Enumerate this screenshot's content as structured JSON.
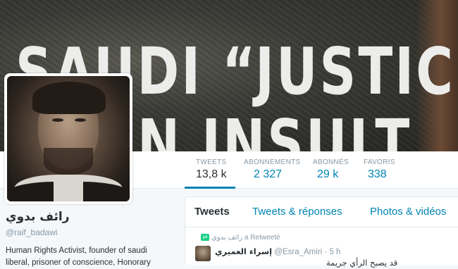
{
  "banner": {
    "line1": "SAUDI “JUSTICE”",
    "line2": "N INSULT"
  },
  "stats": [
    {
      "label": "TWEETS",
      "value": "13,8 k"
    },
    {
      "label": "ABONNEMENTS",
      "value": "2 327"
    },
    {
      "label": "ABONNÉS",
      "value": "29 k"
    },
    {
      "label": "FAVORIS",
      "value": "338"
    }
  ],
  "profile": {
    "name": "رائف بدوي",
    "handle": "@raif_badawi",
    "bio_line1": "Human Rights Activist, founder of saudi",
    "bio_line2": "liberal, prisoner of conscience, Honorary"
  },
  "timeline": {
    "tabs": [
      "Tweets",
      "Tweets & réponses",
      "Photos & vidéos"
    ],
    "retweet_note": "رائف بدوي a Retweeté",
    "tweet": {
      "author": "إسراء العميري",
      "handle": "@Esra_Amiri",
      "time": "5 h",
      "text": "قد يصبح الرأي جريمة"
    }
  },
  "colors": {
    "link": "#0084b4",
    "text": "#292f33",
    "muted": "#8899a6",
    "retweet": "#19cf86"
  }
}
